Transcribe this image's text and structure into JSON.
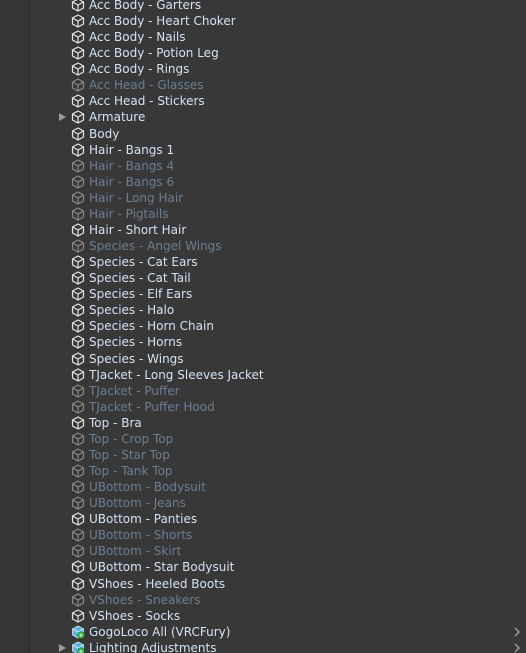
{
  "hierarchy": {
    "rows": [
      {
        "label": "Acc Body - Garters",
        "active": true,
        "icon": "gameobject-icon"
      },
      {
        "label": "Acc Body - Heart Choker",
        "active": true,
        "icon": "gameobject-icon"
      },
      {
        "label": "Acc Body - Nails",
        "active": true,
        "icon": "gameobject-icon"
      },
      {
        "label": "Acc Body - Potion Leg",
        "active": true,
        "icon": "gameobject-icon"
      },
      {
        "label": "Acc Body - Rings",
        "active": true,
        "icon": "gameobject-icon"
      },
      {
        "label": "Acc Head - Glasses",
        "active": false,
        "icon": "gameobject-icon"
      },
      {
        "label": "Acc Head - Stickers",
        "active": true,
        "icon": "gameobject-icon"
      },
      {
        "label": "Armature",
        "active": true,
        "icon": "gameobject-icon",
        "foldout": true
      },
      {
        "label": "Body",
        "active": true,
        "icon": "gameobject-icon"
      },
      {
        "label": "Hair - Bangs 1",
        "active": true,
        "icon": "gameobject-icon"
      },
      {
        "label": "Hair - Bangs 4",
        "active": false,
        "icon": "gameobject-icon"
      },
      {
        "label": "Hair - Bangs 6",
        "active": false,
        "icon": "gameobject-icon"
      },
      {
        "label": "Hair - Long Hair",
        "active": false,
        "icon": "gameobject-icon"
      },
      {
        "label": "Hair - Pigtails",
        "active": false,
        "icon": "gameobject-icon"
      },
      {
        "label": "Hair - Short Hair",
        "active": true,
        "icon": "gameobject-icon"
      },
      {
        "label": "Species - Angel Wings",
        "active": false,
        "icon": "gameobject-icon"
      },
      {
        "label": "Species - Cat Ears",
        "active": true,
        "icon": "gameobject-icon"
      },
      {
        "label": "Species - Cat Tail",
        "active": true,
        "icon": "gameobject-icon"
      },
      {
        "label": "Species - Elf Ears",
        "active": true,
        "icon": "gameobject-icon"
      },
      {
        "label": "Species - Halo",
        "active": true,
        "icon": "gameobject-icon"
      },
      {
        "label": "Species - Horn Chain",
        "active": true,
        "icon": "gameobject-icon"
      },
      {
        "label": "Species - Horns",
        "active": true,
        "icon": "gameobject-icon"
      },
      {
        "label": "Species - Wings",
        "active": true,
        "icon": "gameobject-icon"
      },
      {
        "label": "TJacket - Long Sleeves Jacket",
        "active": true,
        "icon": "gameobject-icon"
      },
      {
        "label": "TJacket - Puffer",
        "active": false,
        "icon": "gameobject-icon"
      },
      {
        "label": "TJacket - Puffer Hood",
        "active": false,
        "icon": "gameobject-icon"
      },
      {
        "label": "Top - Bra",
        "active": true,
        "icon": "gameobject-icon"
      },
      {
        "label": "Top - Crop Top",
        "active": false,
        "icon": "gameobject-icon"
      },
      {
        "label": "Top - Star Top",
        "active": false,
        "icon": "gameobject-icon"
      },
      {
        "label": "Top - Tank Top",
        "active": false,
        "icon": "gameobject-icon"
      },
      {
        "label": "UBottom - Bodysuit",
        "active": false,
        "icon": "gameobject-icon"
      },
      {
        "label": "UBottom - Jeans",
        "active": false,
        "icon": "gameobject-icon"
      },
      {
        "label": "UBottom - Panties",
        "active": true,
        "icon": "gameobject-icon"
      },
      {
        "label": "UBottom - Shorts",
        "active": false,
        "icon": "gameobject-icon"
      },
      {
        "label": "UBottom - Skirt",
        "active": false,
        "icon": "gameobject-icon"
      },
      {
        "label": "UBottom - Star Bodysuit",
        "active": true,
        "icon": "gameobject-icon"
      },
      {
        "label": "VShoes - Heeled Boots",
        "active": true,
        "icon": "gameobject-icon"
      },
      {
        "label": "VShoes - Sneakers",
        "active": false,
        "icon": "gameobject-icon"
      },
      {
        "label": "VShoes - Socks",
        "active": true,
        "icon": "gameobject-icon"
      },
      {
        "label": "GogoLoco All (VRCFury)",
        "active": true,
        "icon": "prefab-icon",
        "chevron": true
      },
      {
        "label": "Lighting Adjustments",
        "active": true,
        "icon": "prefab-icon",
        "foldout": true,
        "chevron": true
      }
    ]
  },
  "colors": {
    "background": "#383838",
    "active_text": "#d2e3f5",
    "inactive_text": "#6a7f93",
    "prefab_accent": "#4fb8ea",
    "prefab_badge": "#3dbb4b"
  }
}
